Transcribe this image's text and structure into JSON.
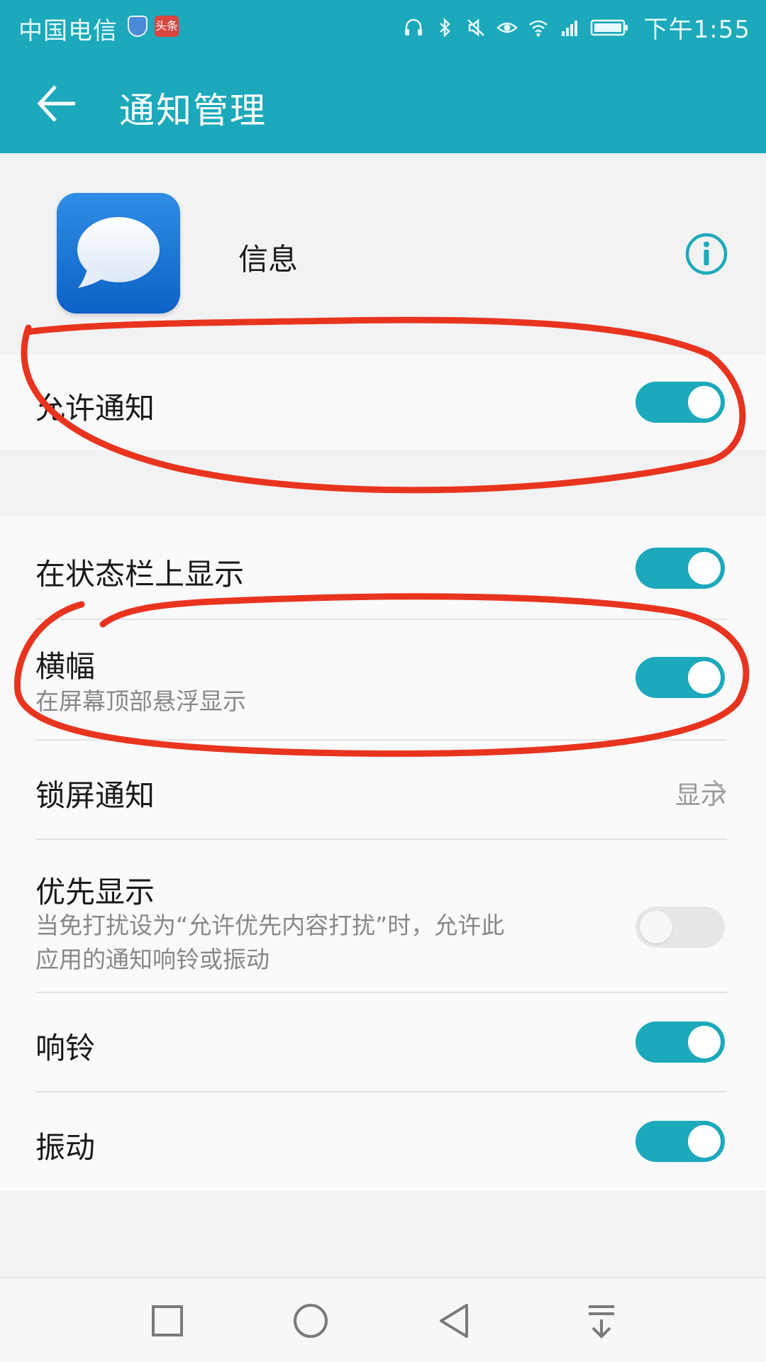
{
  "status_bar": {
    "carrier": "中国电信",
    "news_badge": "头条",
    "time": "下午1:55",
    "icons": [
      "headset-icon",
      "bluetooth-icon",
      "mute-icon",
      "eye-icon",
      "wifi-icon",
      "signal-4g-icon",
      "battery-icon"
    ]
  },
  "toolbar": {
    "title": "通知管理",
    "back_icon": "back-arrow-icon"
  },
  "app": {
    "name": "信息",
    "icon": "message-bubble-icon",
    "info_icon": "info-icon"
  },
  "settings": {
    "allow_notifications": {
      "label": "允许通知",
      "on": true
    },
    "status_bar_display": {
      "label": "在状态栏上显示",
      "on": true
    },
    "banner": {
      "label": "横幅",
      "sub": "在屏幕顶部悬浮显示",
      "on": true
    },
    "lock_screen": {
      "label": "锁屏通知",
      "value": "显示"
    },
    "priority": {
      "label": "优先显示",
      "sub_line1": "当免打扰设为“允许优先内容打扰”时，允许此",
      "sub_line2": "应用的通知响铃或振动",
      "on": false
    },
    "ringtone": {
      "label": "响铃",
      "on": true
    },
    "vibrate": {
      "label": "振动",
      "on": true
    }
  },
  "nav_bar": {
    "icons": [
      "recents-square-icon",
      "home-circle-icon",
      "back-triangle-icon",
      "notification-pull-icon"
    ]
  },
  "colors": {
    "accent": "#1ba9bb",
    "annotation_red": "#e8341f",
    "toggle_off": "#e6e6e6"
  }
}
